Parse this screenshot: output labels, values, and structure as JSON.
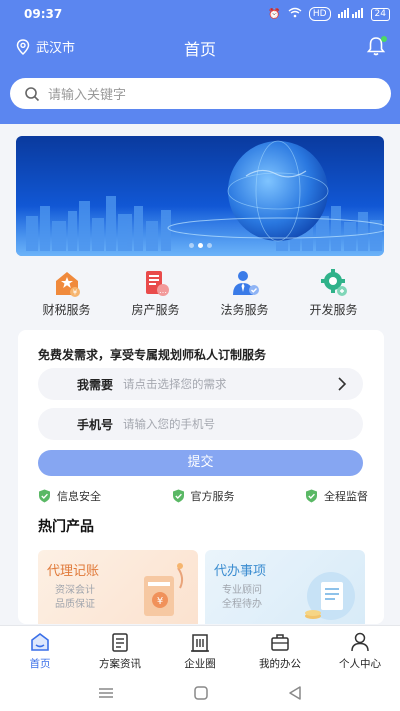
{
  "status_bar": {
    "time": "09:37",
    "hd": "HD",
    "battery": "24"
  },
  "header": {
    "city": "武汉市",
    "title": "首页"
  },
  "search": {
    "placeholder": "请输入关键字"
  },
  "services": [
    {
      "label": "财税服务",
      "icon": "tax-service-icon",
      "color": "#f08a3c"
    },
    {
      "label": "房产服务",
      "icon": "property-service-icon",
      "color": "#e94b4b"
    },
    {
      "label": "法务服务",
      "icon": "legal-service-icon",
      "color": "#3a7be8"
    },
    {
      "label": "开发服务",
      "icon": "dev-service-icon",
      "color": "#2fb28a"
    }
  ],
  "form": {
    "title": "免费发需求，享受专属规划师私人订制服务",
    "need_label": "我需要",
    "need_placeholder": "请点击选择您的需求",
    "phone_label": "手机号",
    "phone_placeholder": "请输入您的手机号",
    "submit_label": "提交",
    "badges": [
      "信息安全",
      "官方服务",
      "全程监督"
    ]
  },
  "hot": {
    "title": "热门产品",
    "products": [
      {
        "title": "代理记账",
        "lines": [
          "资深会计",
          "品质保证"
        ]
      },
      {
        "title": "代办事项",
        "lines": [
          "专业顾问",
          "全程待办"
        ]
      }
    ]
  },
  "tabs": [
    {
      "label": "首页",
      "icon": "home-icon",
      "active": true
    },
    {
      "label": "方案资讯",
      "icon": "news-icon",
      "active": false
    },
    {
      "label": "企业圈",
      "icon": "building-icon",
      "active": false
    },
    {
      "label": "我的办公",
      "icon": "briefcase-icon",
      "active": false
    },
    {
      "label": "个人中心",
      "icon": "user-icon",
      "active": false
    }
  ],
  "colors": {
    "primary": "#5b86f0",
    "accent": "#3a6fe8",
    "submit": "#86a6f2",
    "badge_green": "#5ab865"
  }
}
